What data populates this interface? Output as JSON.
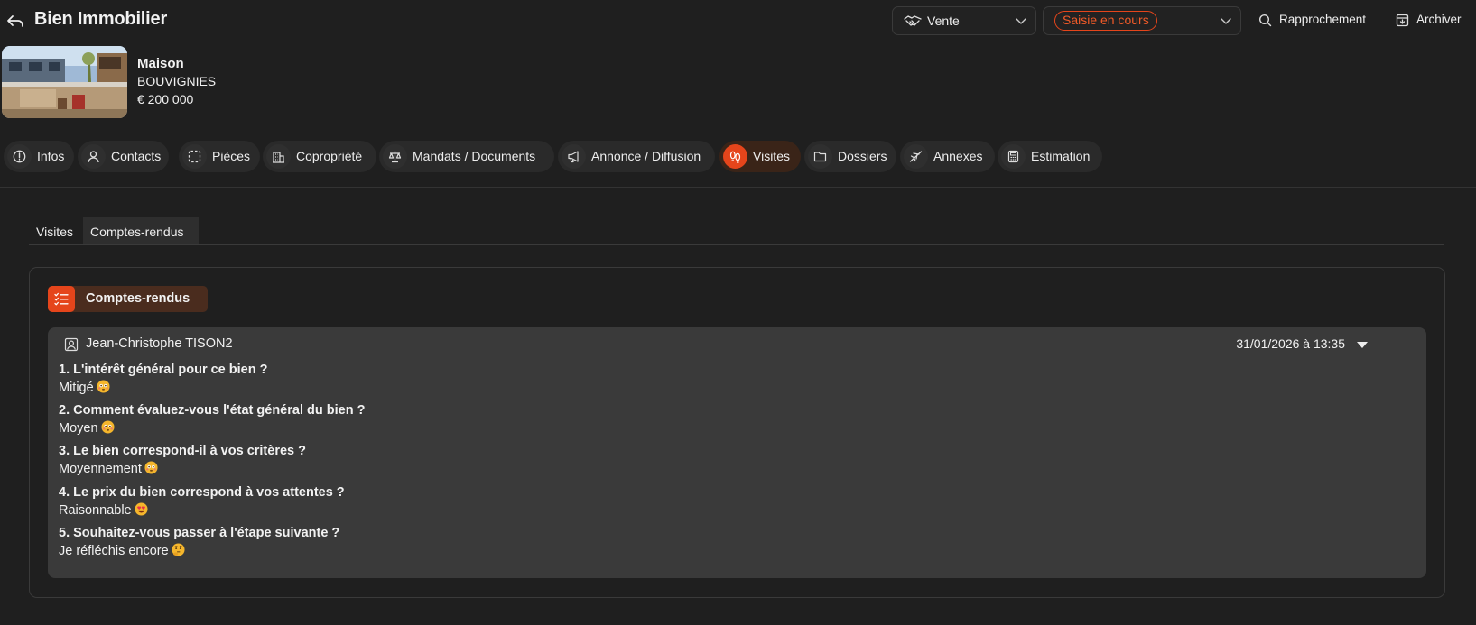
{
  "header": {
    "title": "Bien Immobilier",
    "transaction_select": "Vente",
    "status_select": "Saisie en cours",
    "rapprochement_label": "Rapprochement",
    "archiver_label": "Archiver"
  },
  "property": {
    "type": "Maison",
    "city": "BOUVIGNIES",
    "price": "€ 200 000"
  },
  "main_tabs": [
    {
      "label": "Infos",
      "icon": "info-icon"
    },
    {
      "label": "Contacts",
      "icon": "user-icon"
    },
    {
      "label": "Pièces",
      "icon": "dashed-square-icon"
    },
    {
      "label": "Copropriété",
      "icon": "building-icon"
    },
    {
      "label": "Mandats / Documents",
      "icon": "scale-icon"
    },
    {
      "label": "Annonce / Diffusion",
      "icon": "megaphone-icon"
    },
    {
      "label": "Visites",
      "icon": "footprints-icon",
      "active": true
    },
    {
      "label": "Dossiers",
      "icon": "folder-icon"
    },
    {
      "label": "Annexes",
      "icon": "plane-icon"
    },
    {
      "label": "Estimation",
      "icon": "calculator-icon"
    }
  ],
  "sub_tabs": [
    {
      "label": "Visites"
    },
    {
      "label": "Comptes-rendus",
      "active": true
    }
  ],
  "card": {
    "title": "Comptes-rendus",
    "report": {
      "person": "Jean-Christophe TISON2",
      "date": "31/01/2026 à 13:35",
      "items": [
        {
          "question": "1. L'intérêt général pour ce bien ?",
          "answer": "Mitigé",
          "emoji": "flushed-face-emoji"
        },
        {
          "question": "2. Comment évaluez-vous l'état général du bien ?",
          "answer": "Moyen",
          "emoji": "flushed-face-emoji"
        },
        {
          "question": "3. Le bien correspond-il à vos critères ?",
          "answer": "Moyennement",
          "emoji": "flushed-face-emoji"
        },
        {
          "question": "4. Le prix du bien correspond à vos attentes ?",
          "answer": "Raisonnable",
          "emoji": "heart-eyes-emoji"
        },
        {
          "question": "5. Souhaitez-vous passer à l'étape suivante ?",
          "answer": "Je réfléchis encore",
          "emoji": "thinking-face-emoji"
        }
      ]
    }
  },
  "colors": {
    "accent": "#e5451b",
    "background": "#1f1f1f",
    "report_bg": "#3a3a3a"
  }
}
